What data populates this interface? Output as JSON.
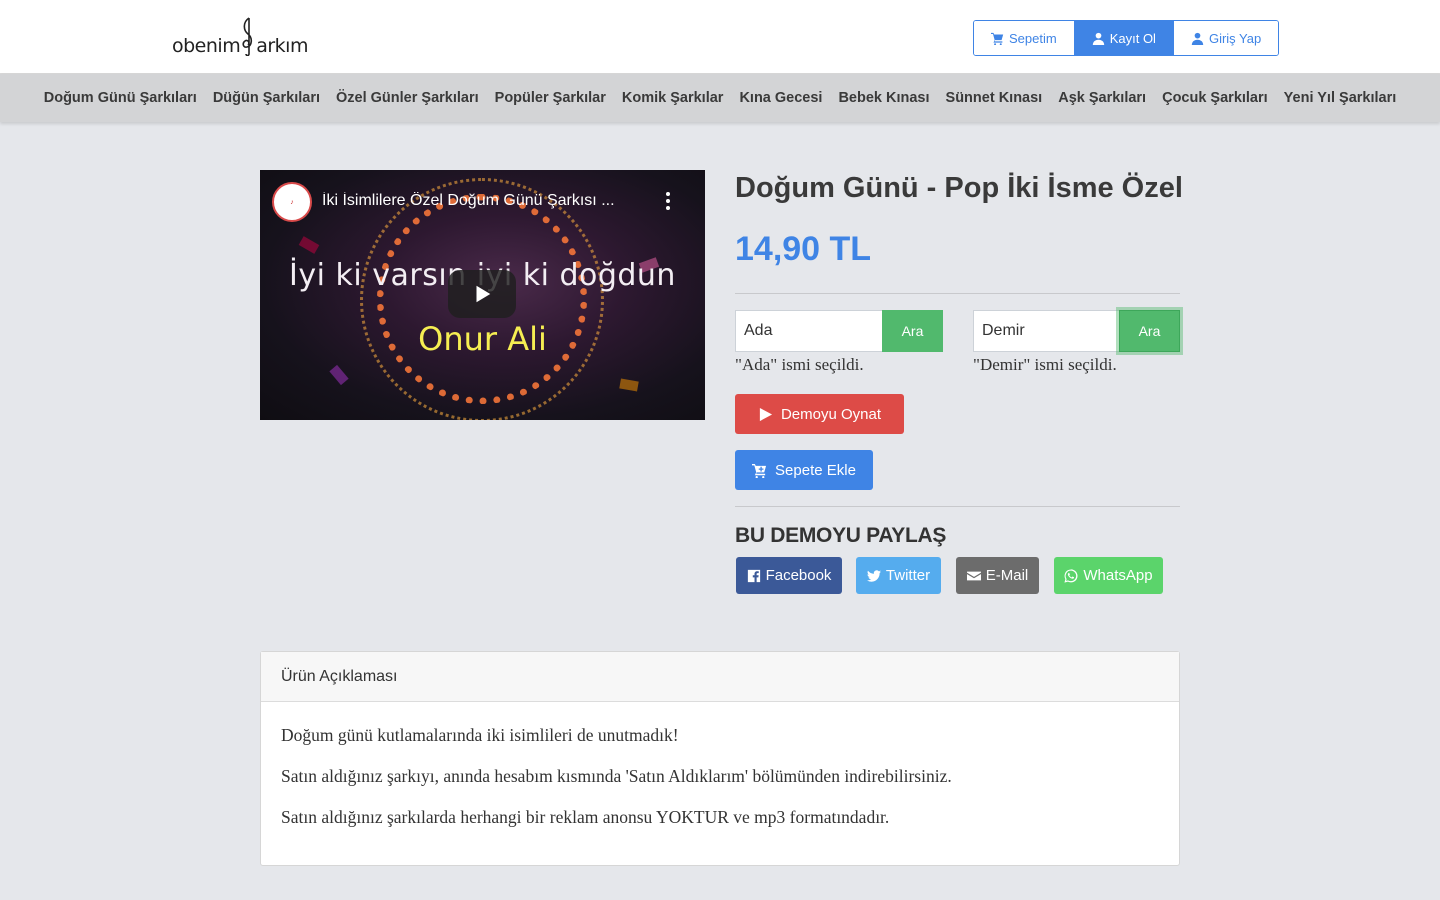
{
  "header": {
    "logo_part1": "obenim",
    "logo_part2": "arkım",
    "auth": [
      {
        "label": "Sepetim",
        "icon": "cart-icon"
      },
      {
        "label": "Kayıt Ol",
        "icon": "user-icon"
      },
      {
        "label": "Giriş Yap",
        "icon": "user-icon"
      }
    ]
  },
  "categories": [
    "Doğum Günü Şarkıları",
    "Düğün Şarkıları",
    "Özel Günler Şarkıları",
    "Popüler Şarkılar",
    "Komik Şarkılar",
    "Kına Gecesi",
    "Bebek Kınası",
    "Sünnet Kınası",
    "Aşk Şarkıları",
    "Çocuk Şarkıları",
    "Yeni Yıl Şarkıları"
  ],
  "video": {
    "title": "İki İsimlilere Özel Doğum Günü Şarkısı ...",
    "line1": "İyi ki varsın iyi ki doğdun",
    "line2": "Onur Ali"
  },
  "product": {
    "title": "Doğum Günü - Pop İki İsme Özel",
    "price": "14,90 TL",
    "name1": {
      "value": "Ada",
      "button": "Ara",
      "note": "\"Ada\" ismi seçildi."
    },
    "name2": {
      "value": "Demir",
      "button": "Ara",
      "note": "\"Demir\" ismi seçildi."
    },
    "demo_button": "Demoyu Oynat",
    "cart_button": "Sepete Ekle",
    "share_heading": "BU DEMOYU PAYLAŞ",
    "share": [
      {
        "label": "Facebook",
        "color": "#3b5998"
      },
      {
        "label": "Twitter",
        "color": "#55acee"
      },
      {
        "label": "E-Mail",
        "color": "#6c6c6c"
      },
      {
        "label": "WhatsApp",
        "color": "#5bd46b"
      }
    ]
  },
  "description": {
    "heading": "Ürün Açıklaması",
    "paragraphs": [
      "Doğum günü kutlamalarında iki isimlileri de unutmadık!",
      "Satın aldığınız şarkıyı, anında hesabım kısmında 'Satın Aldıklarım' bölümünden indirebilirsiniz.",
      "Satın aldığınız şarkılarda herhangi bir reklam anonsu YOKTUR ve mp3 formatındadır."
    ]
  },
  "colors": {
    "primary": "#3f84e5",
    "success": "#51b96d",
    "danger": "#dd4b47",
    "background": "#e5e7eb"
  }
}
